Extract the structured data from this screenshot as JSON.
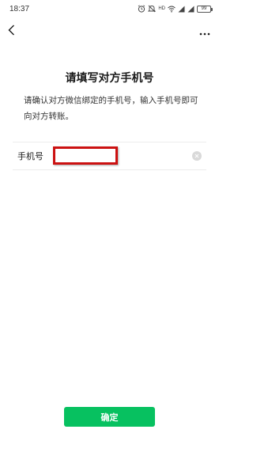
{
  "status_bar": {
    "time": "18:37",
    "hd_label": "HD",
    "battery": "99",
    "icons": [
      "alarm-icon",
      "mute-icon",
      "wifi-icon",
      "signal-icon",
      "signal-icon",
      "battery-icon"
    ]
  },
  "nav": {
    "back_icon": "chevron-left-icon",
    "more_icon": "more-dots-icon"
  },
  "page": {
    "title": "请填写对方手机号",
    "description": "请确认对方微信绑定的手机号，输入手机号即可向对方转账。"
  },
  "form": {
    "phone_label": "手机号",
    "phone_value": "",
    "phone_placeholder": ""
  },
  "actions": {
    "confirm_label": "确定"
  },
  "colors": {
    "accent": "#07c160",
    "highlight": "#cc1111"
  }
}
